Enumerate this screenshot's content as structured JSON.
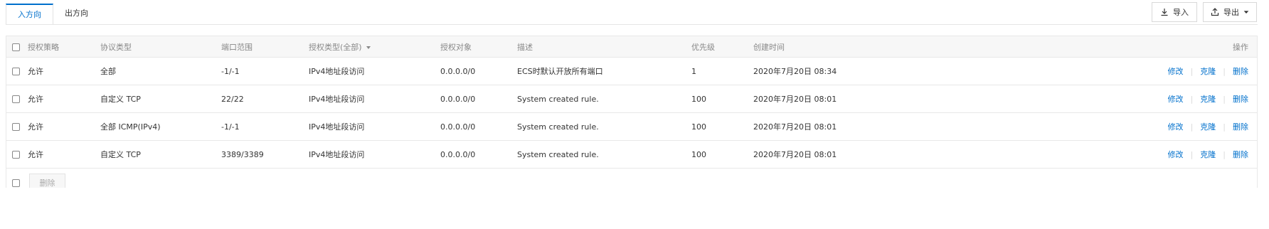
{
  "tabs": [
    {
      "label": "入方向",
      "active": true
    },
    {
      "label": "出方向",
      "active": false
    }
  ],
  "toolbar": {
    "import_label": "导入",
    "export_label": "导出"
  },
  "table": {
    "columns": {
      "policy": "授权策略",
      "protocol": "协议类型",
      "port": "端口范围",
      "auth_type": "授权类型(全部)",
      "auth_object": "授权对象",
      "description": "描述",
      "priority": "优先级",
      "created": "创建时间",
      "actions": "操作"
    },
    "rows": [
      {
        "policy": "允许",
        "protocol": "全部",
        "port": "-1/-1",
        "auth_type": "IPv4地址段访问",
        "auth_object": "0.0.0.0/0",
        "description": "ECS时默认开放所有端口",
        "priority": "1",
        "created": "2020年7月20日 08:34"
      },
      {
        "policy": "允许",
        "protocol": "自定义 TCP",
        "port": "22/22",
        "auth_type": "IPv4地址段访问",
        "auth_object": "0.0.0.0/0",
        "description": "System created rule.",
        "priority": "100",
        "created": "2020年7月20日 08:01"
      },
      {
        "policy": "允许",
        "protocol": "全部 ICMP(IPv4)",
        "port": "-1/-1",
        "auth_type": "IPv4地址段访问",
        "auth_object": "0.0.0.0/0",
        "description": "System created rule.",
        "priority": "100",
        "created": "2020年7月20日 08:01"
      },
      {
        "policy": "允许",
        "protocol": "自定义 TCP",
        "port": "3389/3389",
        "auth_type": "IPv4地址段访问",
        "auth_object": "0.0.0.0/0",
        "description": "System created rule.",
        "priority": "100",
        "created": "2020年7月20日 08:01"
      }
    ],
    "actions": {
      "edit": "修改",
      "clone": "克隆",
      "delete": "删除"
    }
  },
  "footer": {
    "bulk_delete_label": "删除"
  },
  "colors": {
    "accent": "#0070cc",
    "border": "#e8e8e8",
    "header_bg": "#f7f7f7"
  }
}
